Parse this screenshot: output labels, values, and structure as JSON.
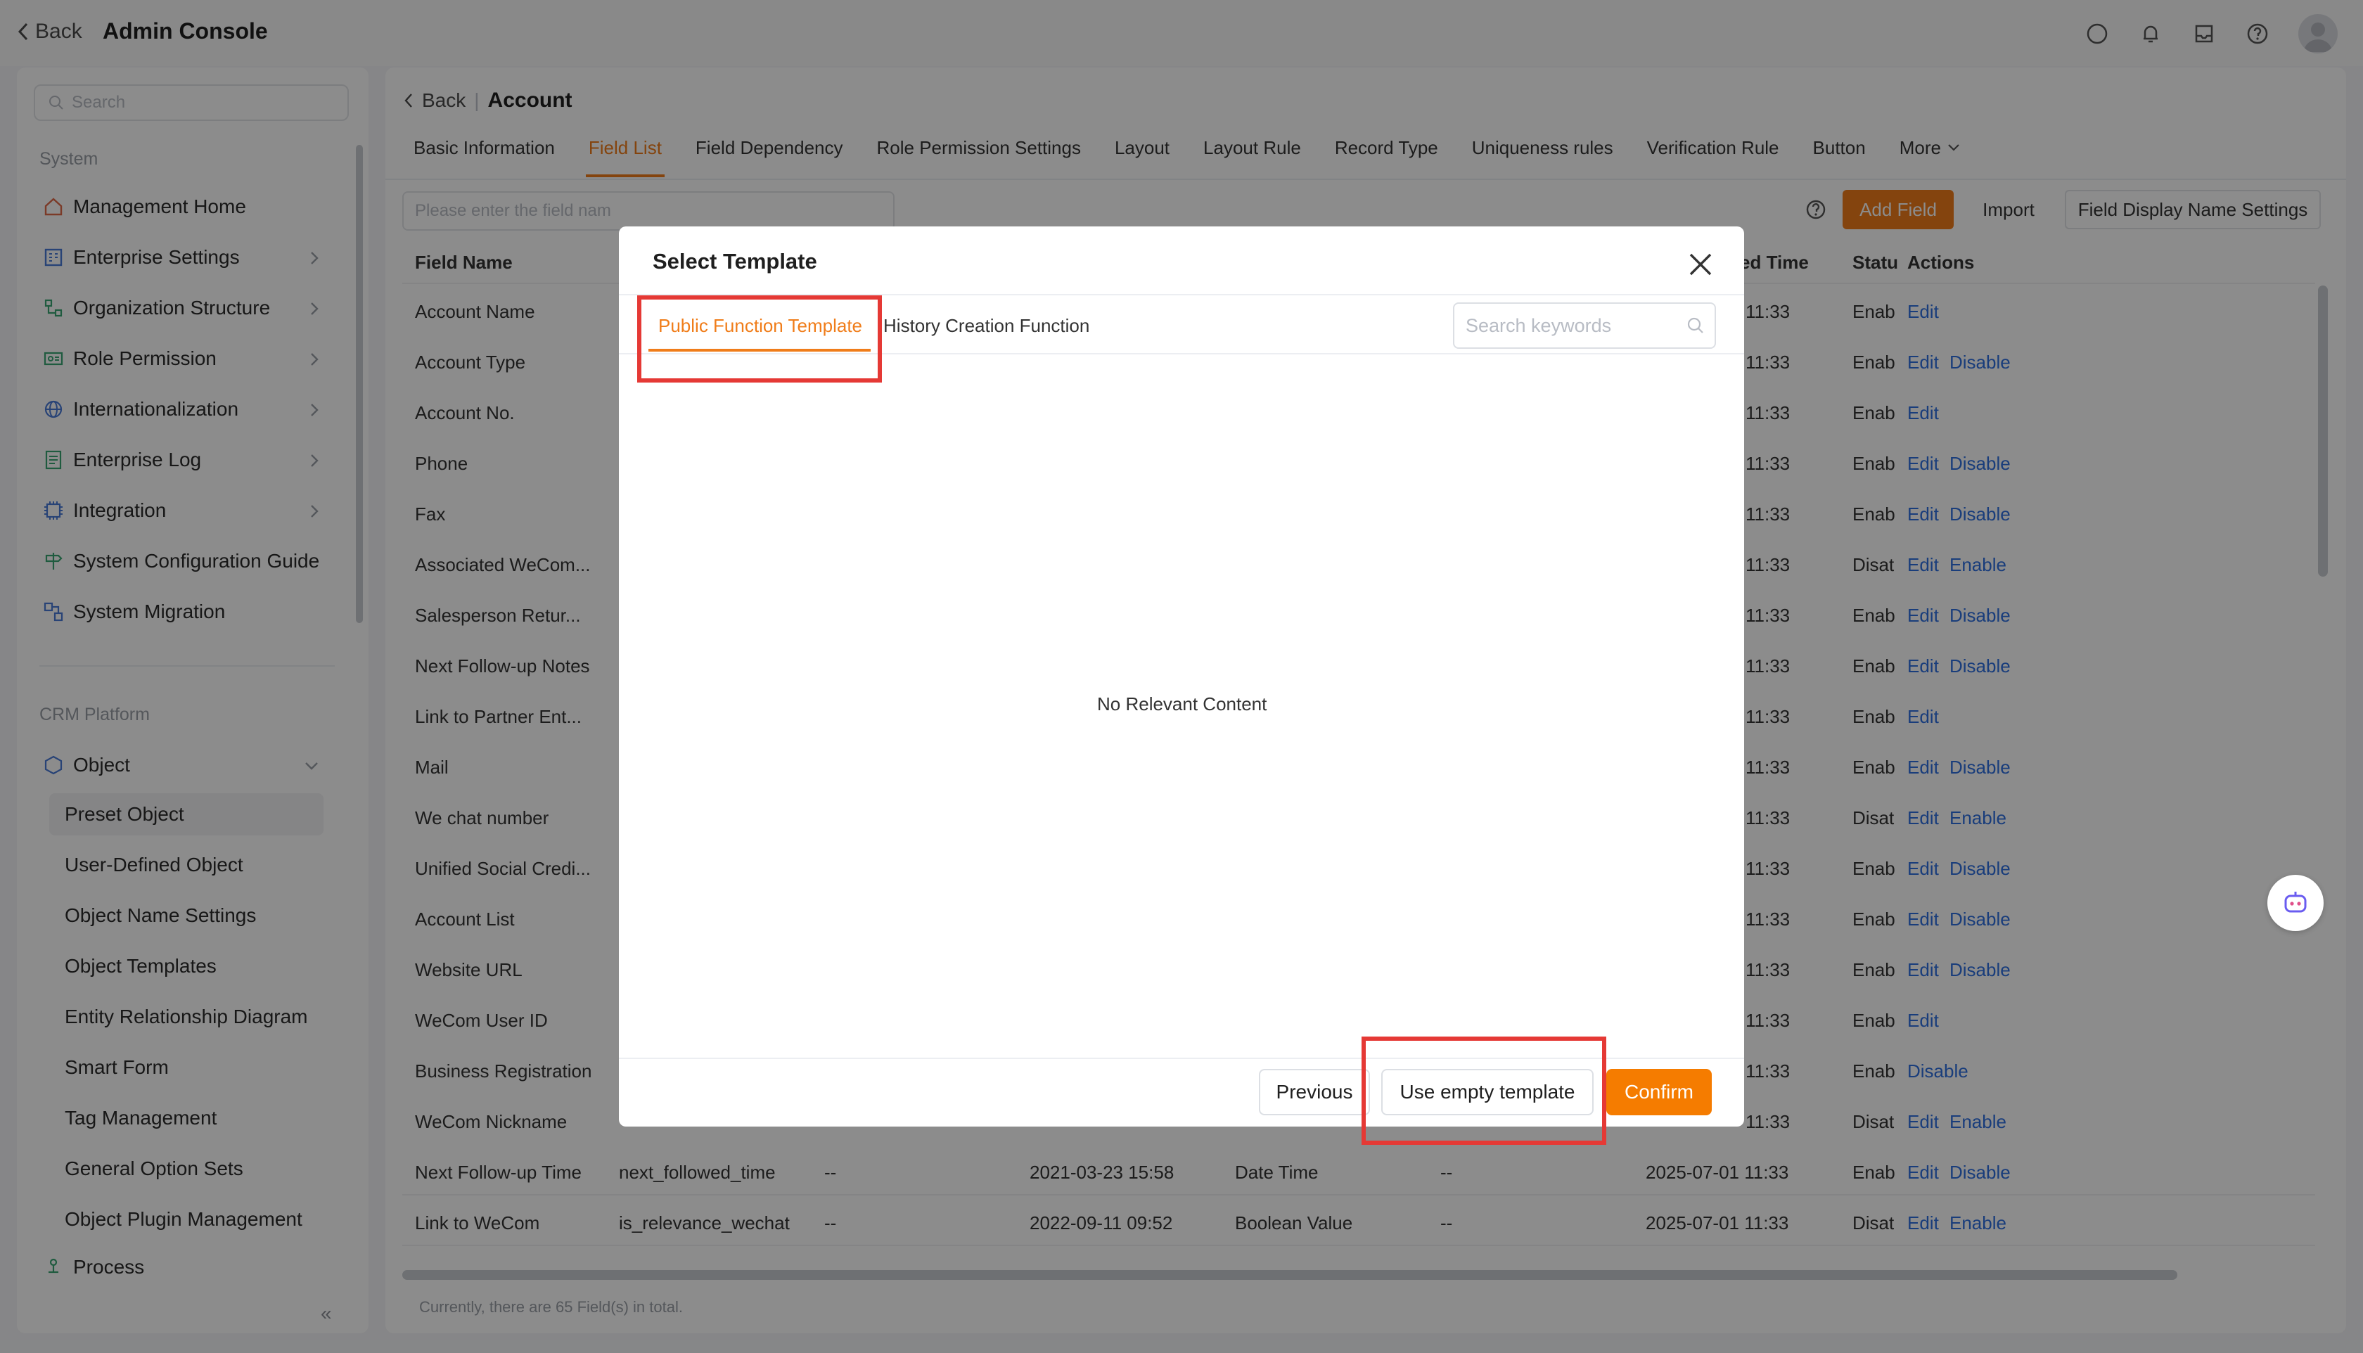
{
  "topbar": {
    "back_label": "Back",
    "title": "Admin Console",
    "icons": [
      "chat-icon",
      "bell-icon",
      "inbox-icon",
      "help-icon"
    ]
  },
  "sidebar": {
    "search_placeholder": "Search",
    "group_system": "System",
    "items": [
      {
        "label": "Management Home",
        "icon": "home-icon"
      },
      {
        "label": "Enterprise Settings",
        "icon": "enterprise-icon"
      },
      {
        "label": "Organization Structure",
        "icon": "org-icon"
      },
      {
        "label": "Role Permission",
        "icon": "role-icon"
      },
      {
        "label": "Internationalization",
        "icon": "globe-icon"
      },
      {
        "label": "Enterprise Log",
        "icon": "log-icon"
      },
      {
        "label": "Integration",
        "icon": "integration-icon"
      },
      {
        "label": "System Configuration Guide",
        "icon": "guide-icon"
      },
      {
        "label": "System Migration",
        "icon": "migration-icon"
      }
    ],
    "group_crm": "CRM Platform",
    "object_label": "Object",
    "sub_items": [
      "Preset Object",
      "User-Defined Object",
      "Object Name Settings",
      "Object Templates",
      "Entity Relationship Diagram",
      "Smart Form",
      "Tag Management",
      "General Option Sets",
      "Object Plugin Management"
    ],
    "process_label": "Process"
  },
  "main": {
    "back_label": "Back",
    "crumb_title": "Account",
    "tabs": [
      "Basic Information",
      "Field List",
      "Field Dependency",
      "Role Permission Settings",
      "Layout",
      "Layout Rule",
      "Record Type",
      "Uniqueness rules",
      "Verification Rule",
      "Button",
      "More"
    ],
    "field_search_placeholder": "Please enter the field nam",
    "add_field": "Add Field",
    "import": "Import",
    "display_name_settings": "Field Display Name Settings",
    "headers": {
      "field_name": "Field Name",
      "updated_time": "ed Time",
      "status": "Statu",
      "actions": "Actions"
    },
    "rows": [
      {
        "name": "Account Name",
        "time": "11:33",
        "status": "Enab",
        "a1": "Edit",
        "a2": ""
      },
      {
        "name": "Account Type",
        "time": "11:33",
        "status": "Enab",
        "a1": "Edit",
        "a2": "Disable"
      },
      {
        "name": "Account No.",
        "time": "11:33",
        "status": "Enab",
        "a1": "Edit",
        "a2": ""
      },
      {
        "name": "Phone",
        "time": "11:33",
        "status": "Enab",
        "a1": "Edit",
        "a2": "Disable"
      },
      {
        "name": "Fax",
        "time": "11:33",
        "status": "Enab",
        "a1": "Edit",
        "a2": "Disable"
      },
      {
        "name": "Associated WeCom...",
        "time": "11:33",
        "status": "Disat",
        "a1": "Edit",
        "a2": "Enable"
      },
      {
        "name": "Salesperson Retur...",
        "time": "11:33",
        "status": "Enab",
        "a1": "Edit",
        "a2": "Disable"
      },
      {
        "name": "Next Follow-up Notes",
        "time": "11:33",
        "status": "Enab",
        "a1": "Edit",
        "a2": "Disable"
      },
      {
        "name": "Link to Partner Ent...",
        "time": "11:33",
        "status": "Enab",
        "a1": "Edit",
        "a2": ""
      },
      {
        "name": "Mail",
        "time": "11:33",
        "status": "Enab",
        "a1": "Edit",
        "a2": "Disable"
      },
      {
        "name": "We chat number",
        "time": "11:33",
        "status": "Disat",
        "a1": "Edit",
        "a2": "Enable"
      },
      {
        "name": "Unified Social Credi...",
        "time": "11:33",
        "status": "Enab",
        "a1": "Edit",
        "a2": "Disable"
      },
      {
        "name": "Account List",
        "time": "11:33",
        "status": "Enab",
        "a1": "Edit",
        "a2": "Disable"
      },
      {
        "name": "Website URL",
        "time": "11:33",
        "status": "Enab",
        "a1": "Edit",
        "a2": "Disable"
      },
      {
        "name": "WeCom User ID",
        "time": "11:33",
        "status": "Enab",
        "a1": "Edit",
        "a2": ""
      },
      {
        "name": "Business Registration",
        "time": "11:33",
        "status": "Enab",
        "a1": "Disable",
        "a2": ""
      },
      {
        "name": "WeCom Nickname",
        "time": "11:33",
        "status": "Disat",
        "a1": "Edit",
        "a2": "Enable"
      }
    ],
    "full_rows": [
      {
        "name": "Next Follow-up Time",
        "api": "next_followed_time",
        "desc": "--",
        "created": "2021-03-23 15:58",
        "type": "Date Time",
        "dash": "--",
        "updated": "2025-07-01 11:33",
        "status": "Enab",
        "a1": "Edit",
        "a2": "Disable"
      },
      {
        "name": "Link to WeCom",
        "api": "is_relevance_wechat",
        "desc": "--",
        "created": "2022-09-11 09:52",
        "type": "Boolean Value",
        "dash": "--",
        "updated": "2025-07-01 11:33",
        "status": "Disat",
        "a1": "Edit",
        "a2": "Enable"
      }
    ],
    "total_text": "Currently, there are 65 Field(s) in total."
  },
  "modal": {
    "title": "Select Template",
    "tab_public": "Public Function Template",
    "tab_history": "History Creation Function",
    "search_placeholder": "Search keywords",
    "empty_text": "No Relevant Content",
    "previous": "Previous",
    "use_empty": "Use empty template",
    "confirm": "Confirm"
  },
  "colors": {
    "accent": "#f07d1a",
    "link": "#2f6fe0",
    "highlight": "#e53935"
  }
}
